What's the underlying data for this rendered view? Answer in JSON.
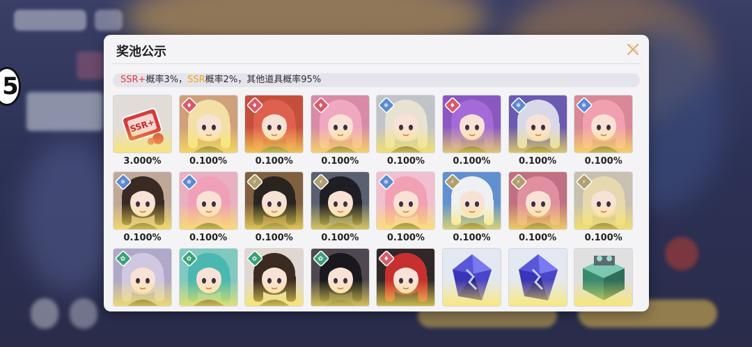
{
  "background": {
    "side_number": "5"
  },
  "panel": {
    "title": "奖池公示",
    "close_icon": "close-x-icon",
    "rate_text": {
      "ssr_plus": "SSR+",
      "ssr_plus_rate": "概率3%，",
      "ssr": "SSR",
      "ssr_rate": "概率2%，",
      "others": "其他道具概率95%"
    },
    "colors": {
      "ssr_plus": "#e03a3a",
      "ssr": "#f0a020"
    }
  },
  "rewards": [
    {
      "name": "ssr-plus-ticket",
      "prob": "3.000%",
      "badge": "none",
      "kind": "ticket"
    },
    {
      "name": "blonde-swordswoman",
      "prob": "0.100%",
      "badge": "fire",
      "hair": "#f2e0a6",
      "bg": "#cfa07a"
    },
    {
      "name": "red-haired-girl",
      "prob": "0.100%",
      "badge": "fire",
      "hair": "#e0604e",
      "bg": "#c4503c"
    },
    {
      "name": "pink-haired-girl",
      "prob": "0.100%",
      "badge": "fire",
      "hair": "#f0a8c0",
      "bg": "#d88aa6"
    },
    {
      "name": "silver-haired-girl",
      "prob": "0.100%",
      "badge": "ice",
      "hair": "#e8e2d2",
      "bg": "#c0c4c8"
    },
    {
      "name": "purple-twintails",
      "prob": "0.100%",
      "badge": "fire",
      "hair": "#a46ad8",
      "bg": "#8a58c0"
    },
    {
      "name": "white-haired-masked",
      "prob": "0.100%",
      "badge": "ice",
      "hair": "#d8d8e8",
      "bg": "#6a5ab0"
    },
    {
      "name": "pink-haired-wink",
      "prob": "0.100%",
      "badge": "ice",
      "hair": "#f2a0b0",
      "bg": "#d88898"
    },
    {
      "name": "glasses-girl",
      "prob": "0.100%",
      "badge": "ice",
      "hair": "#3a2a24",
      "bg": "#c0a898"
    },
    {
      "name": "pink-haired-maid",
      "prob": "0.100%",
      "badge": "ice",
      "hair": "#f0a0b8",
      "bg": "#e8b0c0"
    },
    {
      "name": "dark-haired-gold-armor",
      "prob": "0.100%",
      "badge": "electric",
      "hair": "#2a2420",
      "bg": "#806040"
    },
    {
      "name": "black-white-hair-girl",
      "prob": "0.100%",
      "badge": "electric",
      "hair": "#1e1e24",
      "bg": "#5a6070"
    },
    {
      "name": "pink-bunny-girl",
      "prob": "0.100%",
      "badge": "ice",
      "hair": "#f2a0b4",
      "bg": "#f0c0d0"
    },
    {
      "name": "white-haired-blue",
      "prob": "0.100%",
      "badge": "electric",
      "hair": "#eef0f4",
      "bg": "#6090d0"
    },
    {
      "name": "goggles-girl",
      "prob": "0.100%",
      "badge": "electric",
      "hair": "#e090a0",
      "bg": "#c07080"
    },
    {
      "name": "crowned-blonde",
      "prob": "0.100%",
      "badge": "electric",
      "hair": "#e8d8b0",
      "bg": "#c8c0b0"
    },
    {
      "name": "lavender-hair-girl",
      "prob": "",
      "badge": "wind",
      "hair": "#d0c8e0",
      "bg": "#b0a8c8"
    },
    {
      "name": "teal-hair-girl",
      "prob": "",
      "badge": "wind",
      "hair": "#4ab8b0",
      "bg": "#80c8c0"
    },
    {
      "name": "brown-hair-flower",
      "prob": "",
      "badge": "wind",
      "hair": "#3a2a22",
      "bg": "#e0d8d0"
    },
    {
      "name": "black-hair-horns",
      "prob": "",
      "badge": "wind",
      "hair": "#18181e",
      "bg": "#504850"
    },
    {
      "name": "red-hair-cap",
      "prob": "",
      "badge": "fire",
      "hair": "#c83030",
      "bg": "#302828"
    },
    {
      "name": "purple-crystal-1",
      "prob": "",
      "badge": "none",
      "kind": "crystal"
    },
    {
      "name": "purple-crystal-2",
      "prob": "",
      "badge": "none",
      "kind": "crystal"
    },
    {
      "name": "green-material-box",
      "prob": "",
      "badge": "none",
      "kind": "box"
    }
  ]
}
